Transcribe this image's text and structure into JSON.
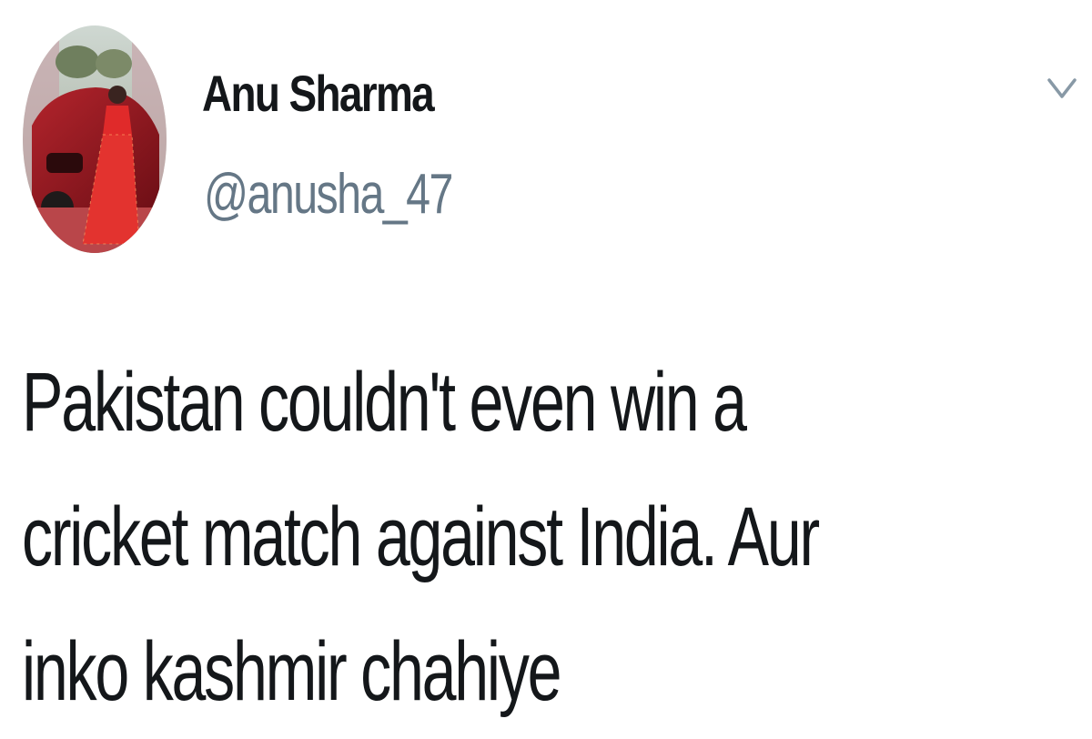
{
  "tweet": {
    "author": {
      "display_name": "Anu Sharma",
      "handle": "@anusha_47",
      "avatar_icon": "profile-photo"
    },
    "menu_icon": "chevron-down-icon",
    "text_lines": [
      "Pakistan couldn't even win a",
      "cricket match against India. Aur",
      "inko kashmir chahiye"
    ]
  },
  "colors": {
    "text_primary": "#14171a",
    "text_secondary": "#657786",
    "caret": "#8899a6"
  }
}
